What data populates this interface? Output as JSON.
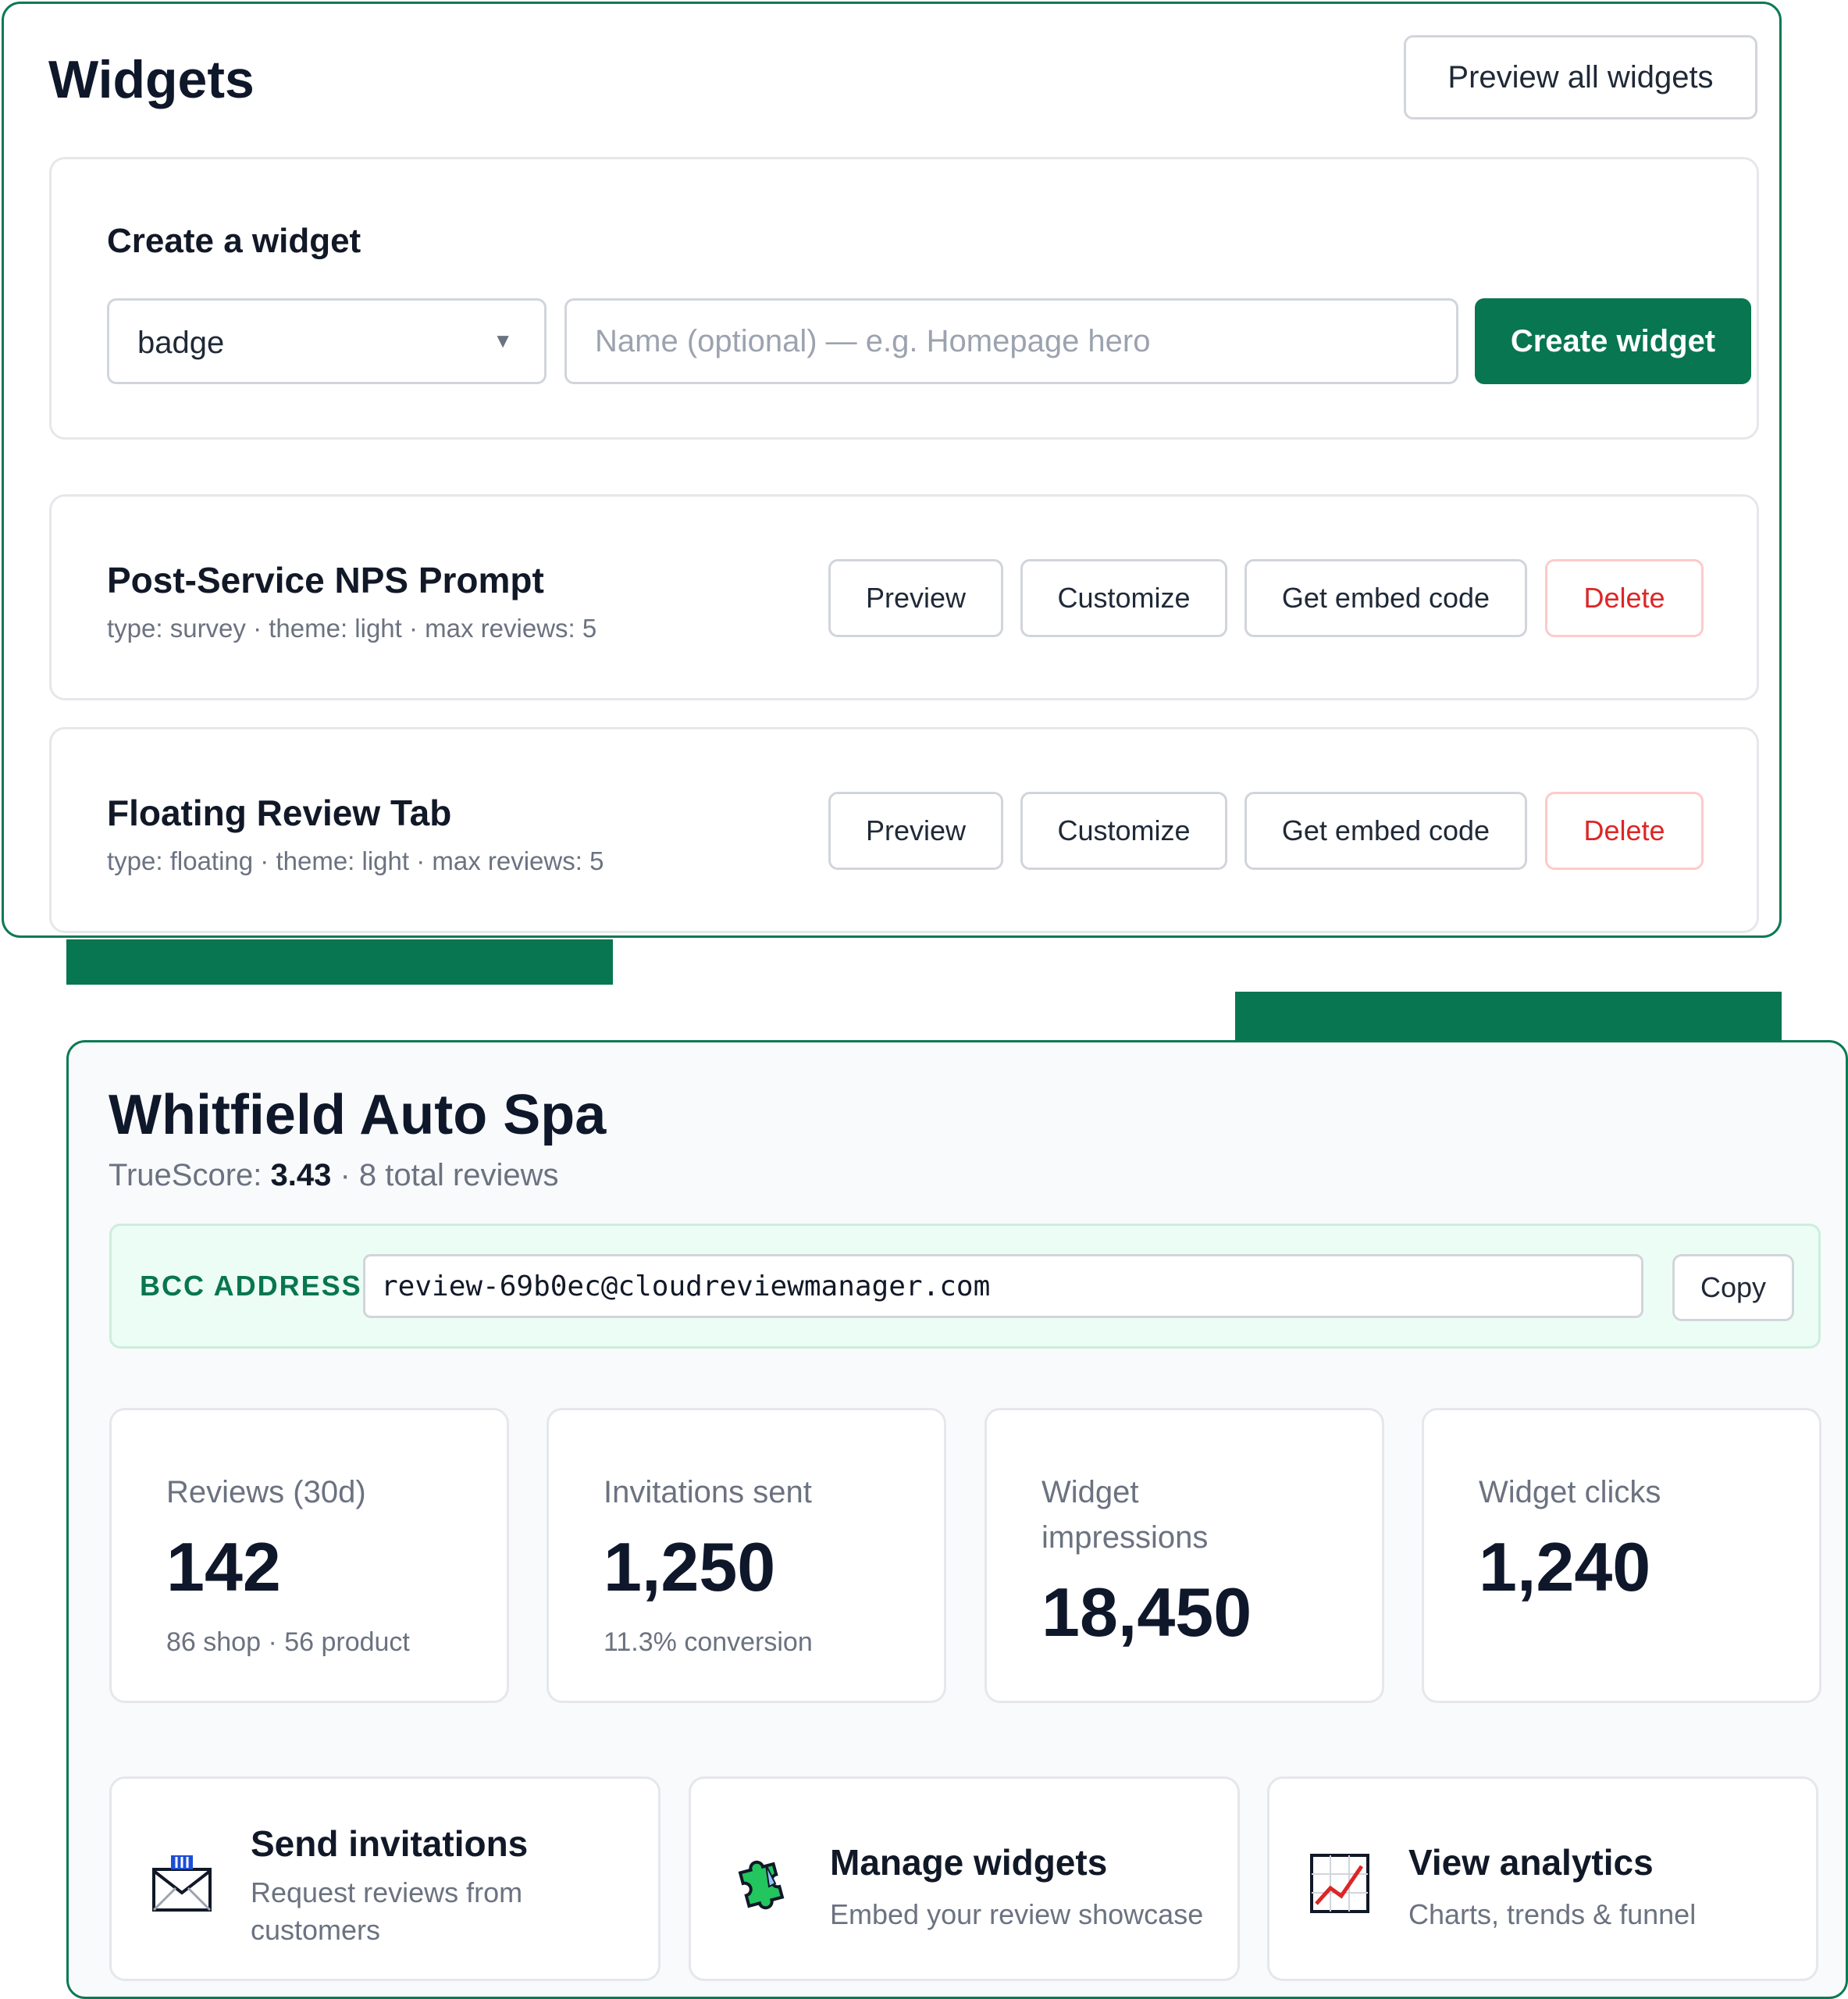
{
  "widgets_panel": {
    "title": "Widgets",
    "preview_all_label": "Preview all widgets",
    "create": {
      "label": "Create a widget",
      "type_select_value": "badge",
      "name_placeholder": "Name (optional) — e.g. Homepage hero",
      "name_value": "",
      "create_button_label": "Create widget"
    },
    "widgets": [
      {
        "name": "Post-Service NPS Prompt",
        "meta": "type: survey · theme: light · max reviews: 5",
        "preview_label": "Preview",
        "customize_label": "Customize",
        "embed_label": "Get embed code",
        "delete_label": "Delete"
      },
      {
        "name": "Floating Review Tab",
        "meta": "type: floating · theme: light · max reviews: 5",
        "preview_label": "Preview",
        "customize_label": "Customize",
        "embed_label": "Get embed code",
        "delete_label": "Delete"
      }
    ]
  },
  "dashboard": {
    "business_name": "Whitfield Auto Spa",
    "truescore_label": "TrueScore: ",
    "truescore_value": "3.43",
    "total_reviews_text": " · 8 total reviews",
    "bcc": {
      "label": "BCC ADDRESS",
      "address": "review-69b0ec@cloudreviewmanager.com",
      "copy_label": "Copy"
    },
    "stats": [
      {
        "label": "Reviews (30d)",
        "value": "142",
        "note": "86 shop · 56 product"
      },
      {
        "label": "Invitations sent",
        "value": "1,250",
        "note": "11.3% conversion"
      },
      {
        "label": "Widget impressions",
        "value": "18,450",
        "note": ""
      },
      {
        "label": "Widget clicks",
        "value": "1,240",
        "note": ""
      }
    ],
    "quick_actions": [
      {
        "icon": "envelope-icon",
        "title": "Send invitations",
        "desc": "Request reviews from customers"
      },
      {
        "icon": "puzzle-icon",
        "title": "Manage widgets",
        "desc": "Embed your review showcase"
      },
      {
        "icon": "chart-icon",
        "title": "View analytics",
        "desc": "Charts, trends & funnel"
      }
    ]
  },
  "colors": {
    "accent": "#087650",
    "danger": "#dc2626",
    "bcc_bg": "#ecfdf5"
  }
}
